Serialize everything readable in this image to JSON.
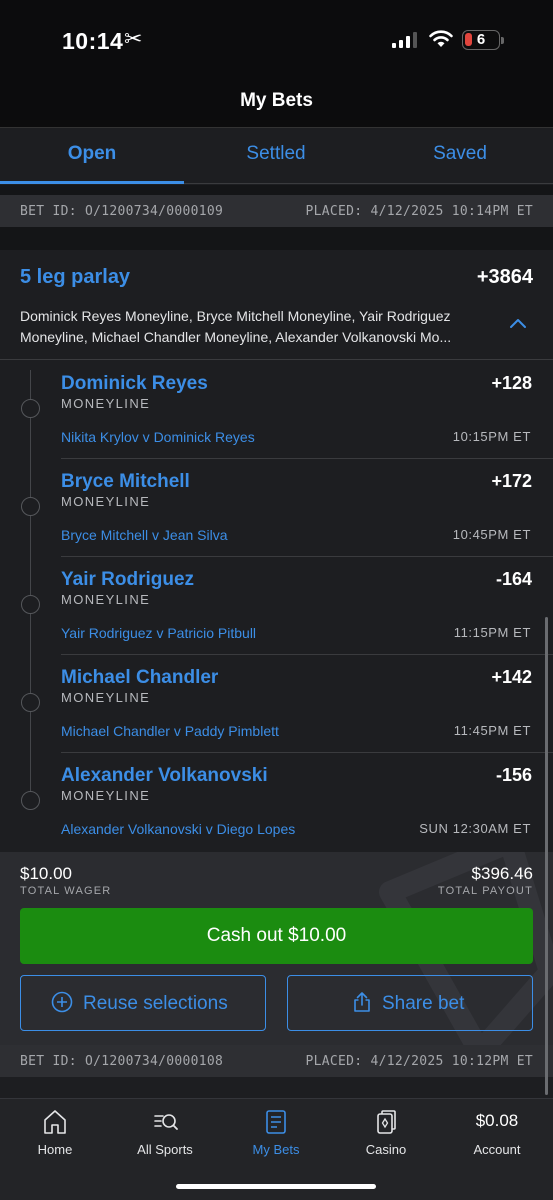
{
  "status_bar": {
    "time": "10:14",
    "battery": "6"
  },
  "header": {
    "title": "My Bets"
  },
  "tabs": [
    {
      "label": "Open",
      "active": true
    },
    {
      "label": "Settled",
      "active": false
    },
    {
      "label": "Saved",
      "active": false
    }
  ],
  "bets": [
    {
      "bet_id": "BET ID: O/1200734/0000109",
      "placed": "PLACED: 4/12/2025 10:14PM ET",
      "title": "5 leg parlay",
      "odds": "+3864",
      "description": "Dominick Reyes Moneyline, Bryce Mitchell Moneyline, Yair Rodriguez Moneyline, Michael Chandler Moneyline, Alexander Volkanovski Mo...",
      "legs": [
        {
          "name": "Dominick Reyes",
          "type": "MONEYLINE",
          "odds": "+128",
          "event": "Nikita Krylov v Dominick Reyes",
          "time": "10:15PM ET"
        },
        {
          "name": "Bryce Mitchell",
          "type": "MONEYLINE",
          "odds": "+172",
          "event": "Bryce Mitchell v Jean Silva",
          "time": "10:45PM ET"
        },
        {
          "name": "Yair Rodriguez",
          "type": "MONEYLINE",
          "odds": "-164",
          "event": "Yair Rodriguez v Patricio Pitbull",
          "time": "11:15PM ET"
        },
        {
          "name": "Michael Chandler",
          "type": "MONEYLINE",
          "odds": "+142",
          "event": "Michael Chandler v Paddy Pimblett",
          "time": "11:45PM ET"
        },
        {
          "name": "Alexander Volkanovski",
          "type": "MONEYLINE",
          "odds": "-156",
          "event": "Alexander Volkanovski v Diego Lopes",
          "time": "SUN 12:30AM ET"
        }
      ],
      "total_wager": "$10.00",
      "total_wager_label": "TOTAL WAGER",
      "total_payout": "$396.46",
      "total_payout_label": "TOTAL PAYOUT",
      "cashout_label": "Cash out $10.00",
      "reuse_label": "Reuse selections",
      "share_label": "Share bet"
    },
    {
      "bet_id": "BET ID: O/1200734/0000108",
      "placed": "PLACED: 4/12/2025 10:12PM ET"
    }
  ],
  "bottom_nav": [
    {
      "label": "Home",
      "icon": "home-icon"
    },
    {
      "label": "All Sports",
      "icon": "all-sports-icon"
    },
    {
      "label": "My Bets",
      "icon": "my-bets-icon",
      "active": true
    },
    {
      "label": "Casino",
      "icon": "casino-icon"
    },
    {
      "label": "Account",
      "balance": "$0.08"
    }
  ],
  "colors": {
    "accent": "#3c8ee6",
    "cashout": "#1b8c10",
    "background": "#1d1e21"
  }
}
